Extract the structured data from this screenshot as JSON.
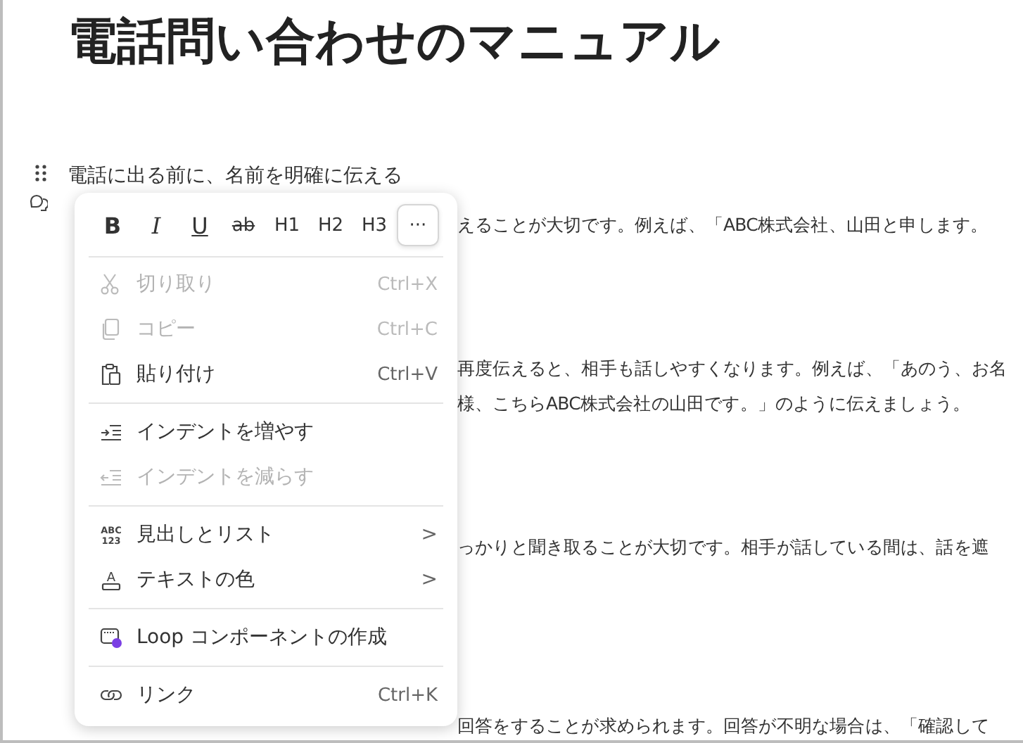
{
  "title": "電話問い合わせのマニュアル",
  "sections": [
    {
      "heading": "電話に出る前に、名前を明確に伝える",
      "body": [
        {
          "text": "えることが大切です。例えば、「ABC株式会社、山田と申します。"
        }
      ]
    },
    {
      "body": [
        {
          "text": "再度伝えると、相手も話しやすくなります。例えば、「あのう、お名"
        },
        {
          "text": "様、こちらABC株式会社の山田です。」のように伝えましょう。"
        }
      ]
    },
    {
      "body": [
        {
          "text": "っかりと聞き取ることが大切です。相手が話している間は、話を遮"
        }
      ]
    },
    {
      "body": [
        {
          "text": "回答をすることが求められます。回答が不明な場合は、「確認して"
        }
      ]
    }
  ],
  "menu": {
    "toolbar": [
      {
        "kind": "bold",
        "label": "B",
        "selected": false
      },
      {
        "kind": "italic",
        "label": "I",
        "selected": false
      },
      {
        "kind": "underline",
        "label": "U",
        "selected": false
      },
      {
        "kind": "strike",
        "label": "ab",
        "selected": false
      },
      {
        "kind": "heading",
        "label": "H1",
        "selected": false
      },
      {
        "kind": "heading",
        "label": "H2",
        "selected": false
      },
      {
        "kind": "heading",
        "label": "H3",
        "selected": false
      },
      {
        "kind": "more",
        "label": "···",
        "selected": true
      }
    ],
    "groups": [
      [
        {
          "label": "切り取り",
          "shortcut": "Ctrl+X",
          "disabled": true
        },
        {
          "label": "コピー",
          "shortcut": "Ctrl+C",
          "disabled": true
        },
        {
          "label": "貼り付け",
          "shortcut": "Ctrl+V",
          "disabled": false
        }
      ],
      [
        {
          "label": "インデントを増やす",
          "disabled": false
        },
        {
          "label": "インデントを減らす",
          "disabled": true
        }
      ],
      [
        {
          "icon_text": [
            "ABC",
            "123"
          ],
          "label": "見出しとリスト",
          "submenu": ">",
          "disabled": false
        },
        {
          "icon_text": [
            "A"
          ],
          "label": "テキストの色",
          "submenu": ">",
          "disabled": false
        }
      ],
      [
        {
          "label": "Loop コンポーネントの作成",
          "disabled": false
        }
      ],
      [
        {
          "label": "リンク",
          "shortcut": "Ctrl+K",
          "disabled": false
        }
      ]
    ]
  }
}
